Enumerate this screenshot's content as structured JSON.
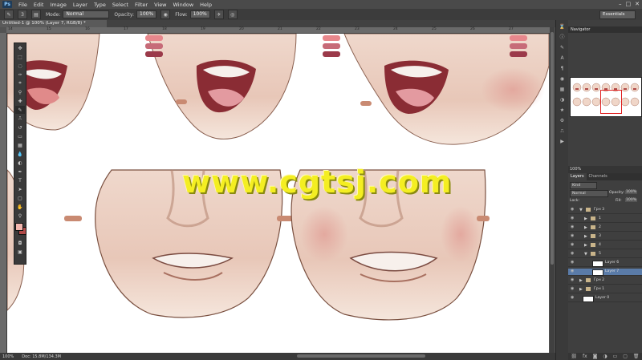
{
  "app": {
    "logo": "Ps"
  },
  "menu": [
    "File",
    "Edit",
    "Image",
    "Layer",
    "Type",
    "Select",
    "Filter",
    "View",
    "Window",
    "Help"
  ],
  "window_controls": [
    "–",
    "□",
    "✕"
  ],
  "options": {
    "mode_label": "Mode:",
    "mode_value": "Normal",
    "opacity_label": "Opacity:",
    "opacity_value": "100%",
    "flow_label": "Flow:",
    "flow_value": "100%",
    "workspace": "Essentials",
    "brush_size": "3"
  },
  "document_tab": "Untitled-1 @ 100% (Layer 7, RGB/8) *",
  "ruler_numbers": [
    "14",
    "15",
    "16",
    "17",
    "18",
    "19",
    "20",
    "21",
    "22",
    "23",
    "24",
    "25",
    "26",
    "27"
  ],
  "status": {
    "zoom": "100%",
    "doc": "Doc: 15.8M/134.3M"
  },
  "watermark": "www.cgtsj.com",
  "navigator": {
    "title": "Navigator",
    "zoom": "100%"
  },
  "layers_panel": {
    "tabs": [
      "Layers",
      "Channels"
    ],
    "kind_label": "Kind",
    "blend_mode": "Normal",
    "opacity_label": "Opacity:",
    "opacity_value": "100%",
    "lock_label": "Lock:",
    "fill_label": "Fill:",
    "fill_value": "100%",
    "rows": [
      {
        "name": "Грн 3",
        "type": "group",
        "indent": 0,
        "open": true
      },
      {
        "name": "1",
        "type": "group",
        "indent": 1,
        "open": false
      },
      {
        "name": "2",
        "type": "group",
        "indent": 1,
        "open": false
      },
      {
        "name": "3",
        "type": "group",
        "indent": 1,
        "open": false
      },
      {
        "name": "4",
        "type": "group",
        "indent": 1,
        "open": false
      },
      {
        "name": "5",
        "type": "group",
        "indent": 1,
        "open": true
      },
      {
        "name": "Layer 6",
        "type": "layer",
        "indent": 2,
        "open": false
      },
      {
        "name": "Layer 7",
        "type": "layer",
        "indent": 2,
        "open": false,
        "selected": true
      },
      {
        "name": "Грн 2",
        "type": "group",
        "indent": 0,
        "open": false
      },
      {
        "name": "Грн 1",
        "type": "group",
        "indent": 0,
        "open": false
      },
      {
        "name": "Layer 0",
        "type": "layer",
        "indent": 0,
        "open": false
      }
    ]
  },
  "colors": {
    "foreground": "#f2b6ae",
    "background": "#b04a48",
    "lip_swatch_1": "#e8878c",
    "lip_swatch_2": "#c76b78",
    "skin_swatch": "#c98a72"
  },
  "tools": [
    "move",
    "marquee",
    "lasso",
    "quick-select",
    "crop",
    "eyedropper",
    "healing",
    "brush",
    "clone",
    "history",
    "eraser",
    "gradient",
    "blur",
    "dodge",
    "pen",
    "type",
    "path-select",
    "shape",
    "hand",
    "zoom"
  ]
}
